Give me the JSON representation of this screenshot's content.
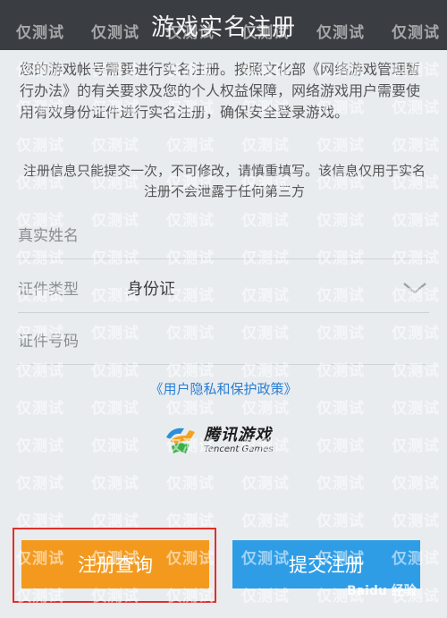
{
  "header": {
    "title": "游戏实名注册"
  },
  "notice": "您的游戏帐号需要进行实名注册。按照文化部《网络游戏管理暂行办法》的有关要求及您的个人权益保障，网络游戏用户需要使用有效身份证件进行实名注册，确保安全登录游戏。",
  "subnotice": "注册信息只能提交一次，不可修改，请慎重填写。该信息仅用于实名注册不会泄露于任何第三方",
  "form": {
    "name_label": "真实姓名",
    "name_value": "",
    "idtype_label": "证件类型",
    "idtype_value": "身份证",
    "idnumber_label": "证件号码",
    "idnumber_value": ""
  },
  "policy_link": "《用户隐私和保护政策》",
  "logo": {
    "cn": "腾讯游戏",
    "en": "Tencent Games"
  },
  "buttons": {
    "query": "注册查询",
    "submit": "提交注册"
  },
  "watermark": {
    "text": "仅测试",
    "baidu": "Baidu 经验"
  },
  "colors": {
    "header": "#3a3d42",
    "query": "#f39a1e",
    "submit": "#2f9de6",
    "link": "#2a7fd4",
    "highlight": "#e0302a"
  }
}
